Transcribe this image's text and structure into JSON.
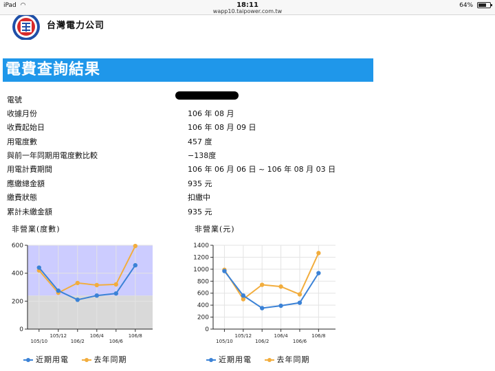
{
  "status_bar": {
    "device": "iPad",
    "time": "18:11",
    "url": "wapp10.taipower.com.tw",
    "battery": "64%"
  },
  "header": {
    "logo_text": "台灣電力公司"
  },
  "page": {
    "title": "電費查詢結果"
  },
  "info_rows": [
    {
      "label": "電號",
      "value": ""
    },
    {
      "label": "收據月份",
      "value": "106 年 08 月"
    },
    {
      "label": "收費起始日",
      "value": "106 年 08 月 09 日"
    },
    {
      "label": "用電度數",
      "value": "457 度"
    },
    {
      "label": "與前一年同期用電度數比較",
      "value": "−138度"
    },
    {
      "label": "用電計費期間",
      "value": "106 年 06 月 06 日 ~ 106 年 08 月 03 日"
    },
    {
      "label": "應繳總金額",
      "value": "935 元"
    },
    {
      "label": "繳費狀態",
      "value": "扣繳中"
    },
    {
      "label": "累計未繳金額",
      "value": "935 元"
    }
  ],
  "colors": {
    "accent": "#1f97ea",
    "recent": "#3b82d6",
    "last_year": "#f2ad3d"
  },
  "chart_data": [
    {
      "type": "line",
      "title": "非營業(度數)",
      "categories": [
        "105/10",
        "105/12",
        "106/2",
        "106/4",
        "106/6",
        "106/8"
      ],
      "ylim": [
        0,
        600
      ],
      "yticks": [
        0,
        200,
        400,
        600
      ],
      "grid": true,
      "legend": "bottom-left",
      "bands": [
        {
          "from": 0,
          "to": 240,
          "color": "#d9d9d9"
        },
        {
          "from": 240,
          "to": 600,
          "color": "#ccccff"
        }
      ],
      "series": [
        {
          "name": "近期用電",
          "color": "#3b82d6",
          "values": [
            440,
            275,
            210,
            240,
            255,
            457
          ]
        },
        {
          "name": "去年同期",
          "color": "#f2ad3d",
          "values": [
            420,
            260,
            330,
            315,
            320,
            595
          ]
        }
      ]
    },
    {
      "type": "line",
      "title": "非營業(元)",
      "categories": [
        "105/10",
        "105/12",
        "106/2",
        "106/4",
        "106/6",
        "106/8"
      ],
      "ylim": [
        0,
        1400
      ],
      "yticks": [
        0,
        200,
        400,
        600,
        800,
        1000,
        1200,
        1400
      ],
      "grid": true,
      "legend": "bottom-left",
      "series": [
        {
          "name": "近期用電",
          "color": "#3b82d6",
          "values": [
            970,
            560,
            350,
            390,
            440,
            935
          ]
        },
        {
          "name": "去年同期",
          "color": "#f2ad3d",
          "values": [
            990,
            500,
            740,
            710,
            580,
            1270
          ]
        }
      ]
    }
  ]
}
